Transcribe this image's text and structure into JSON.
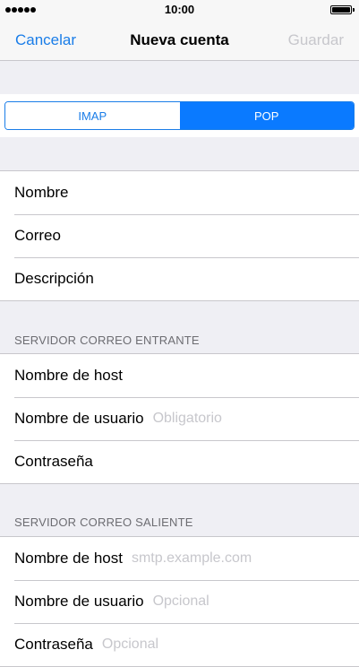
{
  "status": {
    "time": "10:00"
  },
  "nav": {
    "cancel": "Cancelar",
    "title": "Nueva cuenta",
    "save": "Guardar"
  },
  "segment": {
    "imap": "IMAP",
    "pop": "POP",
    "selected": "POP"
  },
  "account": {
    "name": "Nombre",
    "email": "Correo",
    "description": "Descripción"
  },
  "incoming": {
    "header": "SERVIDOR CORREO ENTRANTE",
    "host": "Nombre de host",
    "username": "Nombre de usuario",
    "username_placeholder": "Obligatorio",
    "password": "Contraseña"
  },
  "outgoing": {
    "header": "SERVIDOR CORREO SALIENTE",
    "host": "Nombre de host",
    "host_placeholder": "smtp.example.com",
    "username": "Nombre de usuario",
    "username_placeholder": "Opcional",
    "password": "Contraseña",
    "password_placeholder": "Opcional"
  }
}
